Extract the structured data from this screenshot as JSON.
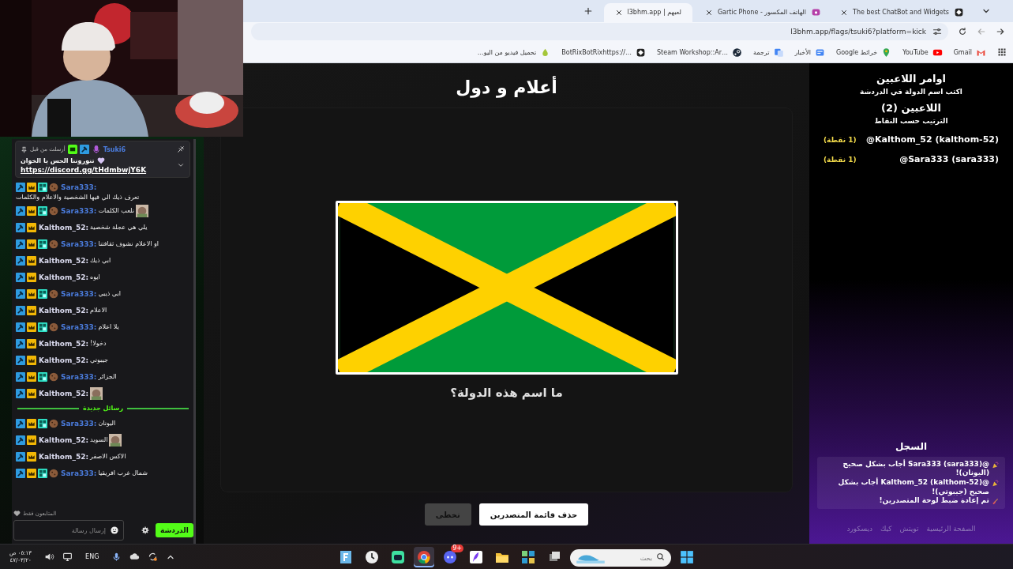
{
  "browser": {
    "tabs": [
      {
        "title": "The best ChatBot and Widgets",
        "kind": "chatbot",
        "selected": false
      },
      {
        "title": "الهاتف المكسور - Gartic Phone",
        "kind": "phone",
        "selected": false
      },
      {
        "title": "لعبهم | l3bhm.app",
        "kind": "none",
        "selected": true
      }
    ],
    "address": "l3bhm.app/flags/tsuki6?platform=kick",
    "bookmarks": [
      {
        "label": "Gmail",
        "kind": "mail"
      },
      {
        "label": "YouTube",
        "kind": "video"
      },
      {
        "label": "خرائط Google",
        "kind": "pin"
      },
      {
        "label": "الأخبار",
        "kind": "news"
      },
      {
        "label": "ترجمة",
        "kind": "translate"
      },
      {
        "label": "Steam Workshop::Ar…",
        "kind": "steam"
      },
      {
        "label": "BotRixBotRixhttps://…",
        "kind": "bot"
      },
      {
        "label": "تحميل فيديو من اليو…",
        "kind": "drop"
      }
    ]
  },
  "chat": {
    "pinned": {
      "author": "Tsuki6",
      "badges": [
        {
          "kind": "bot"
        },
        {
          "kind": "hammer"
        },
        {
          "kind": "mic"
        }
      ],
      "note": "أرسلت من قبل",
      "text": "تنوروننا الحس يا الخوان",
      "link": "https://discord.gg/tHdmbwjY6K"
    },
    "messages": [
      {
        "kind": "message",
        "user": "Sara333:",
        "color": "#4a7bdc",
        "badges": [
          {
            "kind": "hammer"
          },
          {
            "kind": "crown"
          },
          {
            "kind": "og"
          },
          {
            "kind": "cookie"
          }
        ],
        "text": "تعرف ذيك الي فيها الشخصية والاعلام والكلمات",
        "emote": false
      },
      {
        "kind": "message",
        "user": "Sara333:",
        "color": "#4a7bdc",
        "badges": [
          {
            "kind": "hammer"
          },
          {
            "kind": "crown"
          },
          {
            "kind": "og"
          },
          {
            "kind": "cookie"
          }
        ],
        "text": "نلعب الكلمات",
        "emote": true
      },
      {
        "kind": "message",
        "user": "Kalthom_52:",
        "color": "#dcdcf0",
        "badges": [
          {
            "kind": "hammer"
          },
          {
            "kind": "crown"
          }
        ],
        "text": "يلي هي عجلة شخصية",
        "emote": false
      },
      {
        "kind": "message",
        "user": "Sara333:",
        "color": "#4a7bdc",
        "badges": [
          {
            "kind": "hammer"
          },
          {
            "kind": "crown"
          },
          {
            "kind": "og"
          },
          {
            "kind": "cookie"
          }
        ],
        "text": "او الاعلام نشوف ثقافتنا",
        "emote": false
      },
      {
        "kind": "message",
        "user": "Kalthom_52:",
        "color": "#dcdcf0",
        "badges": [
          {
            "kind": "hammer"
          },
          {
            "kind": "crown"
          }
        ],
        "text": "ابي ذيك",
        "emote": false
      },
      {
        "kind": "message",
        "user": "Kalthom_52:",
        "color": "#dcdcf0",
        "badges": [
          {
            "kind": "hammer"
          },
          {
            "kind": "crown"
          }
        ],
        "text": "ايوه",
        "emote": false
      },
      {
        "kind": "message",
        "user": "Sara333:",
        "color": "#4a7bdc",
        "badges": [
          {
            "kind": "hammer"
          },
          {
            "kind": "crown"
          },
          {
            "kind": "og"
          },
          {
            "kind": "cookie"
          }
        ],
        "text": "ابي ذيبي",
        "emote": false
      },
      {
        "kind": "message",
        "user": "Kalthom_52:",
        "color": "#dcdcf0",
        "badges": [
          {
            "kind": "hammer"
          },
          {
            "kind": "crown"
          }
        ],
        "text": "الاعلام",
        "emote": false
      },
      {
        "kind": "message",
        "user": "Sara333:",
        "color": "#4a7bdc",
        "badges": [
          {
            "kind": "hammer"
          },
          {
            "kind": "crown"
          },
          {
            "kind": "og"
          },
          {
            "kind": "cookie"
          }
        ],
        "text": "يلا اعلام",
        "emote": false
      },
      {
        "kind": "message",
        "user": "Kalthom_52:",
        "color": "#dcdcf0",
        "badges": [
          {
            "kind": "hammer"
          },
          {
            "kind": "crown"
          }
        ],
        "text": "دخولا!",
        "emote": false
      },
      {
        "kind": "message",
        "user": "Kalthom_52:",
        "color": "#dcdcf0",
        "badges": [
          {
            "kind": "hammer"
          },
          {
            "kind": "crown"
          }
        ],
        "text": "جيبوتي",
        "emote": false
      },
      {
        "kind": "message",
        "user": "Sara333:",
        "color": "#4a7bdc",
        "badges": [
          {
            "kind": "hammer"
          },
          {
            "kind": "crown"
          },
          {
            "kind": "og"
          },
          {
            "kind": "cookie"
          }
        ],
        "text": "الجزائر",
        "emote": false
      },
      {
        "kind": "message",
        "user": "Kalthom_52:",
        "color": "#dcdcf0",
        "badges": [
          {
            "kind": "hammer"
          },
          {
            "kind": "crown"
          }
        ],
        "emote": true
      },
      {
        "kind": "divider",
        "text": "رسائل جديدة"
      },
      {
        "kind": "message",
        "user": "Sara333:",
        "color": "#4a7bdc",
        "badges": [
          {
            "kind": "hammer"
          },
          {
            "kind": "crown"
          },
          {
            "kind": "og"
          },
          {
            "kind": "cookie"
          }
        ],
        "text": "اليونان",
        "emote": false
      },
      {
        "kind": "message",
        "user": "Kalthom_52:",
        "color": "#dcdcf0",
        "badges": [
          {
            "kind": "hammer"
          },
          {
            "kind": "crown"
          }
        ],
        "text": "السويد",
        "emote": true
      },
      {
        "kind": "message",
        "user": "Kalthom_52:",
        "color": "#dcdcf0",
        "badges": [
          {
            "kind": "hammer"
          },
          {
            "kind": "crown"
          }
        ],
        "text": "الاكس الاصفر",
        "emote": false
      },
      {
        "kind": "message",
        "user": "Sara333:",
        "color": "#4a7bdc",
        "badges": [
          {
            "kind": "hammer"
          },
          {
            "kind": "crown"
          },
          {
            "kind": "og"
          },
          {
            "kind": "cookie"
          }
        ],
        "text": "شمال غرب افريقيا",
        "emote": false
      }
    ],
    "followers_only": "المتابعون فقط",
    "input": {
      "placeholder": "إرسال رسالة"
    },
    "send_button": "الدردشة"
  },
  "game": {
    "title": "أعلام و دول",
    "question": "ما اسم هذه الدولة؟",
    "buttons": [
      {
        "label": "حذف قائمة المتصدرين",
        "kind": "primary"
      },
      {
        "label": "تخطى",
        "kind": "secondary"
      }
    ]
  },
  "sidebar": {
    "title": "اوامر اللاعبين",
    "hint": "اكتب اسم الدولة في الدردشة",
    "players_heading": "اللاعبين (2)",
    "sort_note": "الترتيب حسب النقاط",
    "players": [
      {
        "name": "@Kalthom_52 (kalthom-52)",
        "points": "(1 نقطة)"
      },
      {
        "name": "@Sara333 (sara333)",
        "points": "(1 نقطة)"
      }
    ],
    "log_title": "السجل",
    "log": [
      {
        "kind": "correct",
        "text": "@Sara333 (sara333) أجاب بشكل صحيح (اليونان)!"
      },
      {
        "kind": "correct",
        "text": "@Kalthom_52 (kalthom-52) أجاب بشكل صحيح (جيبوتي)!"
      },
      {
        "kind": "reset",
        "text": "تم إعادة ضبط لوحة المتصدرين!"
      }
    ],
    "footer_links": [
      "الصفحة الرئيسية",
      "تويتش",
      "كيك",
      "ديسكورد"
    ]
  },
  "taskbar": {
    "time": "٠٥:١٣ ص",
    "date": "٤٧/٠٣/٢٠",
    "language": "ENG",
    "search": {
      "placeholder": "بحث"
    },
    "apps": [
      {
        "kind": "tasks",
        "selected": false
      },
      {
        "kind": "tiles",
        "selected": false
      },
      {
        "kind": "folder",
        "selected": false
      },
      {
        "kind": "feather",
        "selected": false
      },
      {
        "kind": "chat",
        "selected": false,
        "badge": "9+"
      },
      {
        "kind": "browser",
        "selected": true
      },
      {
        "kind": "bot",
        "selected": false
      },
      {
        "kind": "clock",
        "selected": false
      },
      {
        "kind": "letter",
        "selected": false
      }
    ]
  }
}
